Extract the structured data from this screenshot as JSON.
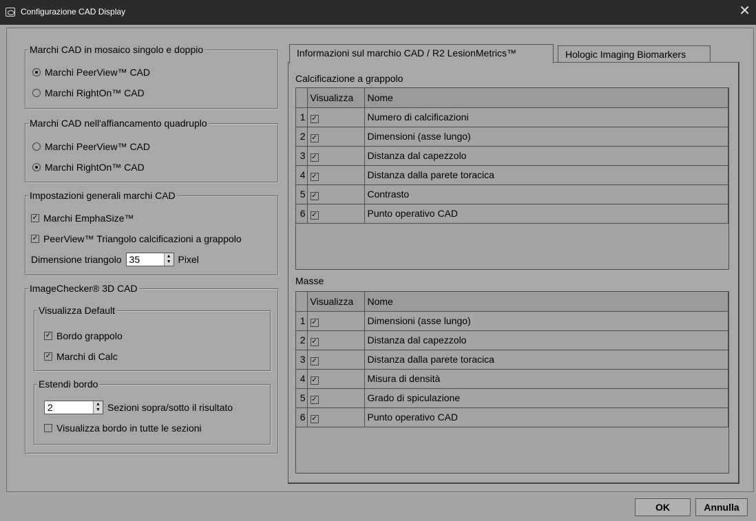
{
  "window": {
    "title": "Configurazione CAD Display",
    "close_glyph": "✕"
  },
  "single_double": {
    "legend": "Marchi CAD in mosaico singolo e doppio",
    "options": [
      {
        "label": "Marchi PeerView™ CAD",
        "selected": true
      },
      {
        "label": "Marchi RightOn™ CAD",
        "selected": false
      }
    ]
  },
  "quad": {
    "legend": "Marchi CAD nell'affiancamento quadruplo",
    "options": [
      {
        "label": "Marchi PeerView™ CAD",
        "selected": false
      },
      {
        "label": "Marchi RightOn™ CAD",
        "selected": true
      }
    ]
  },
  "general": {
    "legend": "Impostazioni generali marchi CAD",
    "emphasize_label": "Marchi EmphaSize™",
    "emphasize_checked": true,
    "triangle_label": "PeerView™ Triangolo calcificazioni a grappolo",
    "triangle_checked": true,
    "size_label": "Dimensione triangolo",
    "size_value": "35",
    "size_unit": "Pixel"
  },
  "imagechecker": {
    "legend": "ImageChecker® 3D CAD",
    "default": {
      "legend": "Visualizza Default",
      "items": [
        {
          "label": "Bordo grappolo",
          "checked": true
        },
        {
          "label": "Marchi di Calc",
          "checked": true
        }
      ]
    },
    "extend": {
      "legend": "Estendi bordo",
      "value": "2",
      "value_label": "Sezioni sopra/sotto il risultato",
      "all_label": "Visualizza bordo in tutte le sezioni",
      "all_checked": false
    }
  },
  "tabs": [
    {
      "label": "Informazioni sul marchio CAD / R2 LesionMetrics™",
      "active": true
    },
    {
      "label": "Hologic Imaging Biomarkers",
      "active": false
    }
  ],
  "columns": {
    "show": "Visualizza",
    "name": "Nome"
  },
  "clusters": {
    "label": "Calcificazione a grappolo",
    "rows": [
      {
        "n": "1",
        "checked": true,
        "name": "Numero di calcificazioni"
      },
      {
        "n": "2",
        "checked": true,
        "name": "Dimensioni (asse lungo)"
      },
      {
        "n": "3",
        "checked": true,
        "name": "Distanza dal capezzolo"
      },
      {
        "n": "4",
        "checked": true,
        "name": "Distanza dalla parete toracica"
      },
      {
        "n": "5",
        "checked": true,
        "name": "Contrasto"
      },
      {
        "n": "6",
        "checked": true,
        "name": "Punto operativo CAD"
      }
    ]
  },
  "masses": {
    "label": "Masse",
    "rows": [
      {
        "n": "1",
        "checked": true,
        "name": "Dimensioni (asse lungo)"
      },
      {
        "n": "2",
        "checked": true,
        "name": "Distanza dal capezzolo"
      },
      {
        "n": "3",
        "checked": true,
        "name": "Distanza dalla parete toracica"
      },
      {
        "n": "4",
        "checked": true,
        "name": "Misura di densità"
      },
      {
        "n": "5",
        "checked": true,
        "name": "Grado di spiculazione"
      },
      {
        "n": "6",
        "checked": true,
        "name": "Punto operativo CAD"
      }
    ]
  },
  "buttons": {
    "ok": "OK",
    "cancel": "Annulla"
  },
  "check_glyph": "✓",
  "spin_up_glyph": "▲",
  "spin_down_glyph": "▼"
}
